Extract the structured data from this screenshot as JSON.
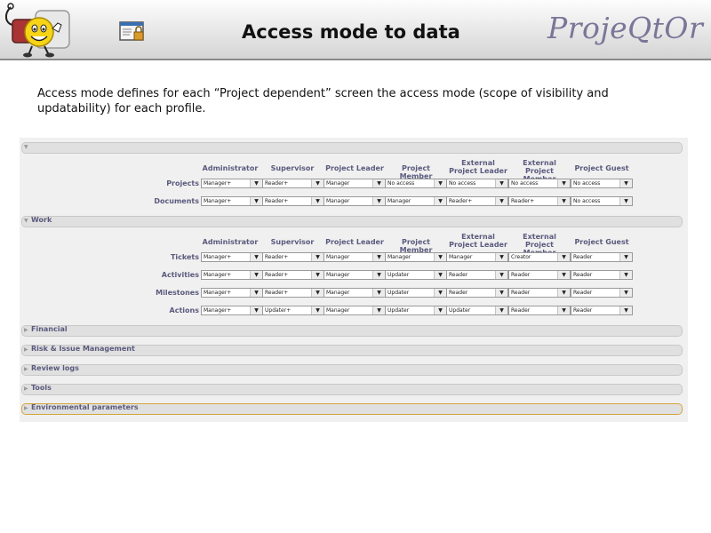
{
  "header": {
    "title": "Access mode to data",
    "logo": "ProjeQtOr"
  },
  "intro": "Access mode defines for each “Project dependent” screen the access mode (scope of visibility and updatability) for each profile.",
  "profiles": [
    "Administrator",
    "Supervisor",
    "Project Leader",
    "Project Member",
    "External\nProject Leader",
    "External\nProject Member",
    "Project Guest"
  ],
  "sections": [
    {
      "label": "",
      "expanded": true,
      "rows": [
        {
          "label": "Projects",
          "values": [
            "Manager+",
            "Reader+",
            "Manager",
            "No access",
            "No access",
            "No access",
            "No access"
          ]
        },
        {
          "label": "Documents",
          "values": [
            "Manager+",
            "Reader+",
            "Manager",
            "Manager",
            "Reader+",
            "Reader+",
            "No access"
          ]
        }
      ]
    },
    {
      "label": "Work",
      "expanded": true,
      "rows": [
        {
          "label": "Tickets",
          "values": [
            "Manager+",
            "Reader+",
            "Manager",
            "Manager",
            "Manager",
            "Creator",
            "Reader"
          ]
        },
        {
          "label": "Activities",
          "values": [
            "Manager+",
            "Reader+",
            "Manager",
            "Updater",
            "Reader",
            "Reader",
            "Reader"
          ]
        },
        {
          "label": "Milestones",
          "values": [
            "Manager+",
            "Reader+",
            "Manager",
            "Updater",
            "Reader",
            "Reader",
            "Reader"
          ]
        },
        {
          "label": "Actions",
          "values": [
            "Manager+",
            "Updater+",
            "Manager",
            "Updater",
            "Updater",
            "Reader",
            "Reader"
          ]
        }
      ]
    },
    {
      "label": "Financial",
      "expanded": false,
      "rows": []
    },
    {
      "label": "Risk & Issue Management",
      "expanded": false,
      "rows": []
    },
    {
      "label": "Review logs",
      "expanded": false,
      "rows": []
    },
    {
      "label": "Tools",
      "expanded": false,
      "rows": []
    },
    {
      "label": "Environmental parameters",
      "expanded": false,
      "highlighted": true,
      "rows": []
    }
  ],
  "icons": {
    "expanded": "triangle-down-icon",
    "collapsed": "triangle-right-icon",
    "dropdown": "chevron-down-icon"
  },
  "colors": {
    "label": "#5a5a7e",
    "logo": "#7b7698",
    "highlight": "#d4a53a"
  }
}
